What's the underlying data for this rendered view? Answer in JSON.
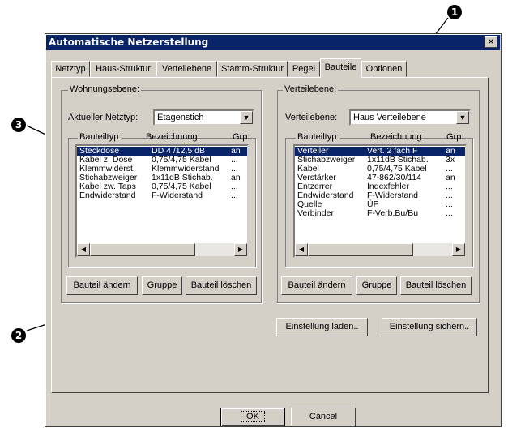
{
  "window": {
    "title": "Automatische Netzerstellung",
    "close_glyph": "✕"
  },
  "tabs": [
    {
      "label": "Netztyp"
    },
    {
      "label": "Haus-Struktur"
    },
    {
      "label": "Verteilebene"
    },
    {
      "label": "Stamm-Struktur"
    },
    {
      "label": "Pegel"
    },
    {
      "label": "Bauteile"
    },
    {
      "label": "Optionen"
    }
  ],
  "left": {
    "group_label": "Wohnungsebene:",
    "netztyp_label": "Aktueller Netztyp:",
    "netztyp_value": "Etagenstich",
    "sub_group_label": "Bauteiltyp:",
    "headers": {
      "bez": "Bezeichnung:",
      "grp": "Grp:"
    },
    "rows": [
      {
        "typ": "Steckdose",
        "bez": "DD   4 /12,5 dB",
        "grp": "an"
      },
      {
        "typ": "Kabel z. Dose",
        "bez": "0,75/4,75 Kabel",
        "grp": "..."
      },
      {
        "typ": "Klemmwiderst.",
        "bez": "Klemmwiderstand",
        "grp": "..."
      },
      {
        "typ": "Stichabzweiger",
        "bez": "1x11dB Stichab.",
        "grp": "an"
      },
      {
        "typ": "Kabel zw. Taps",
        "bez": "0,75/4,75 Kabel",
        "grp": "..."
      },
      {
        "typ": "Endwiderstand",
        "bez": "F-Widerstand",
        "grp": "..."
      }
    ],
    "buttons": {
      "change": "Bauteil ändern",
      "group": "Gruppe",
      "delete": "Bauteil löschen"
    }
  },
  "right": {
    "group_label": "Verteilebene:",
    "select_label": "Verteilebene:",
    "select_value": "Haus Verteilebene",
    "sub_group_label": "Bauteiltyp:",
    "headers": {
      "bez": "Bezeichnung:",
      "grp": "Grp:"
    },
    "rows": [
      {
        "typ": "Verteiler",
        "bez": "Vert. 2 fach  F",
        "grp": "an"
      },
      {
        "typ": "Stichabzweiger",
        "bez": "1x11dB Stichab.",
        "grp": "3x"
      },
      {
        "typ": "Kabel",
        "bez": "0,75/4,75 Kabel",
        "grp": "..."
      },
      {
        "typ": "Verstärker",
        "bez": "47-862/30/114",
        "grp": "an"
      },
      {
        "typ": "Entzerrer",
        "bez": "Indexfehler",
        "grp": "..."
      },
      {
        "typ": "Endwiderstand",
        "bez": "F-Widerstand",
        "grp": "..."
      },
      {
        "typ": "Quelle",
        "bez": "ÜP",
        "grp": "..."
      },
      {
        "typ": "Verbinder",
        "bez": "F-Verb.Bu/Bu",
        "grp": "..."
      }
    ],
    "buttons": {
      "change": "Bauteil ändern",
      "group": "Gruppe",
      "delete": "Bauteil löschen"
    }
  },
  "settings": {
    "load": "Einstellung laden..",
    "save": "Einstellung sichern.."
  },
  "footer": {
    "ok": "OK",
    "cancel": "Cancel"
  },
  "callouts": {
    "one": "1",
    "two": "2",
    "three": "3"
  },
  "icons": {
    "dropdown": "▼",
    "scroll_left": "◀",
    "scroll_right": "▶"
  }
}
